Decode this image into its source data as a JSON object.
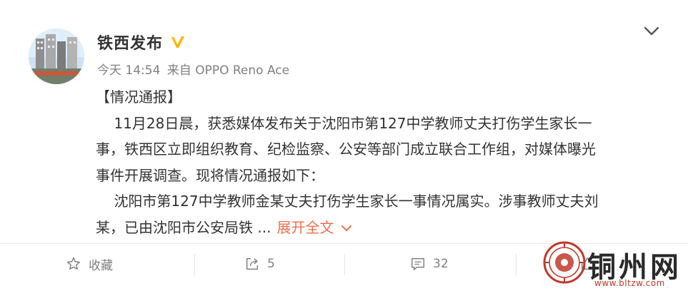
{
  "post": {
    "author": "铁西发布",
    "verified_icon": "verified-v-icon",
    "time": "今天 14:54",
    "source": "来自 OPPO Reno Ace",
    "menu_icon": "chevron-down-icon",
    "body_lines": [
      "【情况通报】",
      "    11月28日晨，获悉媒体发布关于沈阳市第127中学教师丈夫打伤学生家长一",
      "事，铁西区立即组织教育、纪检监察、公安等部门成立联合工作组，对媒体曝光",
      "事件开展调查。现将情况通报如下：",
      "    沈阳市第127中学教师金某丈夫打伤学生家长一事情况属实。涉事教师丈夫刘",
      "某，已由沈阳市公安局铁 ..."
    ],
    "expand_label": "展开全文"
  },
  "actions": {
    "favorite": {
      "label": "收藏",
      "icon": "star-icon"
    },
    "repost": {
      "label": "5",
      "icon": "share-icon"
    },
    "comment": {
      "label": "32",
      "icon": "comment-icon"
    },
    "like": {
      "icon": "thumbs-up-icon"
    }
  },
  "watermark": {
    "brand": "铜州网",
    "url": "www.bltzw.com"
  },
  "colors": {
    "link_accent": "#eb7350",
    "verified": "#ffb400",
    "muted_text": "#808080",
    "watermark_red": "#c0392b"
  }
}
